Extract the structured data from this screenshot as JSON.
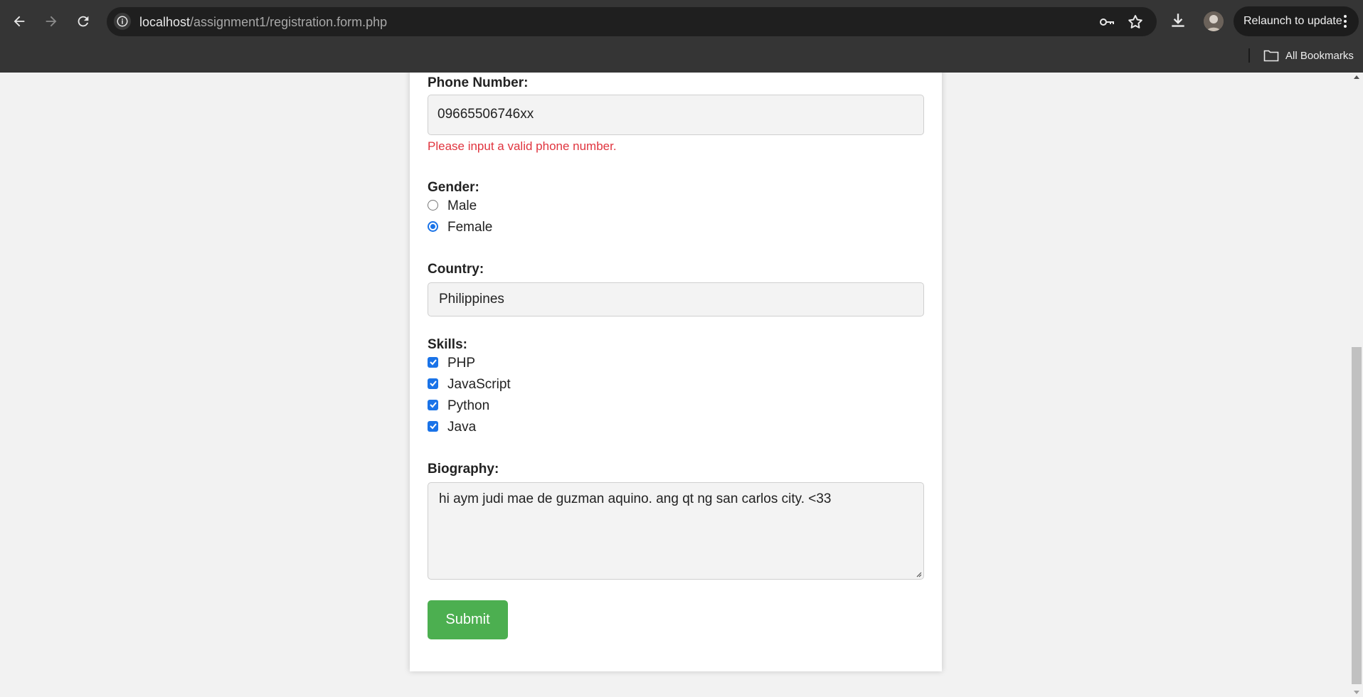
{
  "browser": {
    "url_host": "localhost",
    "url_path": "/assignment1/registration.form.php",
    "relaunch_label": "Relaunch to update",
    "bookmarks_label": "All Bookmarks"
  },
  "form": {
    "phone": {
      "label": "Phone Number:",
      "value": "09665506746xx",
      "error": "Please input a valid phone number."
    },
    "gender": {
      "label": "Gender:",
      "options": [
        {
          "label": "Male",
          "checked": false
        },
        {
          "label": "Female",
          "checked": true
        }
      ]
    },
    "country": {
      "label": "Country:",
      "value": "Philippines"
    },
    "skills": {
      "label": "Skills:",
      "options": [
        {
          "label": "PHP",
          "checked": true
        },
        {
          "label": "JavaScript",
          "checked": true
        },
        {
          "label": "Python",
          "checked": true
        },
        {
          "label": "Java",
          "checked": true
        }
      ]
    },
    "biography": {
      "label": "Biography:",
      "value": "hi aym judi mae de guzman aquino. ang qt ng san carlos city. <33"
    },
    "submit_label": "Submit"
  },
  "colors": {
    "submit": "#4caf50",
    "error": "#e0343e",
    "accent": "#1a73e8"
  }
}
